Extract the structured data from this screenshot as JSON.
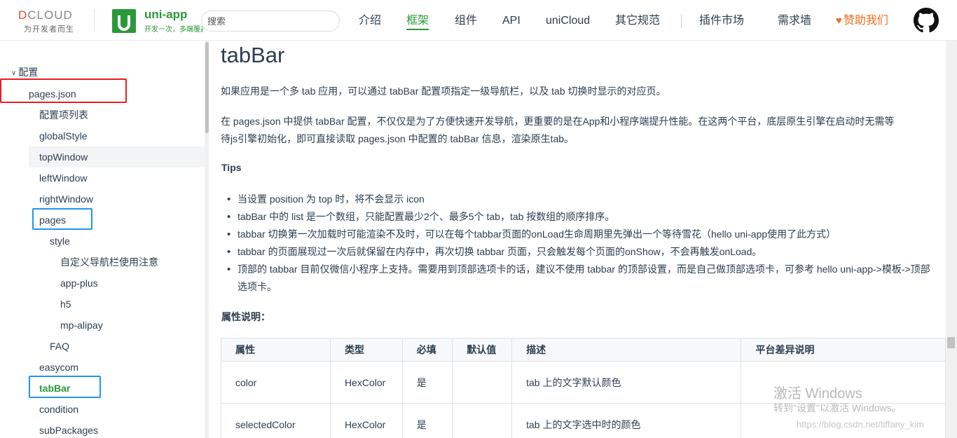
{
  "header": {
    "dcloud_logo_text": "DCLOUD",
    "dcloud_slogan": "为开发者而生",
    "uni_app_name": "uni-app",
    "uni_app_slogan": "开发一次，多端覆盖",
    "search_placeholder": "搜索",
    "nav": [
      "介绍",
      "框架",
      "组件",
      "API",
      "uniCloud",
      "其它规范",
      "插件市场",
      "需求墙"
    ],
    "active_nav": "框架",
    "sponsor_label": "赞助我们",
    "brand_color": "#2b9939",
    "sponsor_color": "#f26b1d",
    "github_icon": "github-icon"
  },
  "sidebar": {
    "items": [
      {
        "label": "配置",
        "expanded": true
      },
      {
        "label": "pages.json"
      },
      {
        "label": "配置项列表"
      },
      {
        "label": "globalStyle"
      },
      {
        "label": "topWindow"
      },
      {
        "label": "leftWindow"
      },
      {
        "label": "rightWindow"
      },
      {
        "label": "pages"
      },
      {
        "label": "style"
      },
      {
        "label": "自定义导航栏使用注意"
      },
      {
        "label": "app-plus"
      },
      {
        "label": "h5"
      },
      {
        "label": "mp-alipay"
      },
      {
        "label": "FAQ"
      },
      {
        "label": "easycom"
      },
      {
        "label": "tabBar",
        "active": true
      },
      {
        "label": "condition"
      },
      {
        "label": "subPackages"
      }
    ]
  },
  "content": {
    "title": "tabBar",
    "intro": "如果应用是一个多 tab 应用，可以通过 tabBar 配置项指定一级导航栏，以及 tab 切换时显示的对应页。",
    "para2_line1": "在 pages.json 中提供 tabBar 配置，不仅仅是为了方便快速开发导航，更重要的是在App和小程序端提升性能。在这两个平台，底层原生引擎在启动时无需等",
    "para2_line2": "待js引擎初始化，即可直接读取 pages.json 中配置的 tabBar 信息，渲染原生tab。",
    "tips_heading": "Tips",
    "tips": [
      "当设置 position 为 top 时，将不会显示 icon",
      "tabBar 中的 list 是一个数组，只能配置最少2个、最多5个 tab，tab 按数组的顺序排序。",
      "tabbar 切换第一次加载时可能渲染不及时，可以在每个tabbar页面的onLoad生命周期里先弹出一个等待雪花（hello uni-app使用了此方式）",
      "tabbar 的页面展现过一次后就保留在内存中，再次切换 tabbar 页面，只会触发每个页面的onShow，不会再触发onLoad。",
      "顶部的 tabbar 目前仅微信小程序上支持。需要用到顶部选项卡的话，建议不使用 tabbar 的顶部设置，而是自己做顶部选项卡，可参考 hello uni-app->模板->顶部选项卡。"
    ],
    "attr_heading": "属性说明：",
    "table": {
      "headers": [
        "属性",
        "类型",
        "必填",
        "默认值",
        "描述",
        "平台差异说明"
      ],
      "rows": [
        [
          "color",
          "HexColor",
          "是",
          "",
          "tab 上的文字默认颜色",
          ""
        ],
        [
          "selectedColor",
          "HexColor",
          "是",
          "",
          "tab 上的文字选中时的颜色",
          ""
        ]
      ]
    }
  },
  "watermark": {
    "line1": "激活 Windows",
    "line2": "转到\"设置\"以激活 Windows。",
    "url": "https://blog.csdn.net/tiffany_kim"
  }
}
